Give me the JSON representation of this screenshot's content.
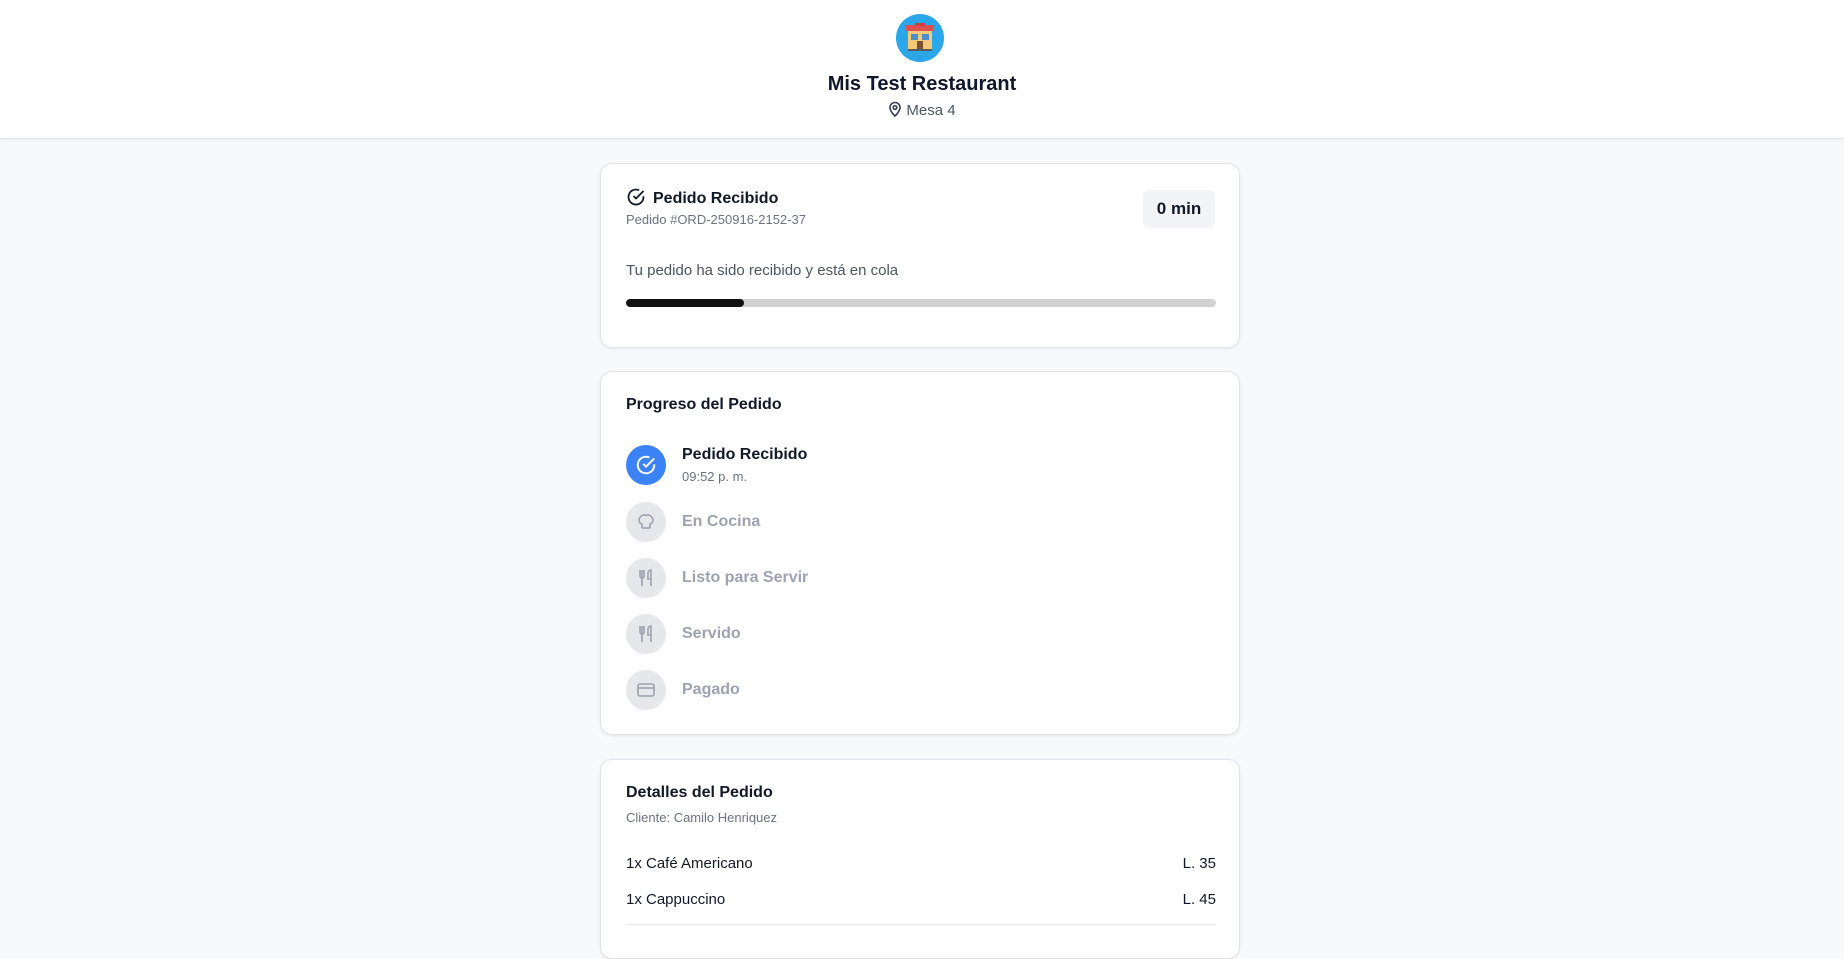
{
  "header": {
    "restaurant_name": "Mis Test Restaurant",
    "table_label": "Mesa 4",
    "logo_icon": "store-icon",
    "location_icon": "map-pin-icon"
  },
  "status_card": {
    "title": "Pedido Recibido",
    "order_number": "Pedido #ORD-250916-2152-37",
    "elapsed": "0 min",
    "description": "Tu pedido ha sido recibido y está en cola",
    "progress_fraction": 0.2
  },
  "progress_card": {
    "heading": "Progreso del Pedido",
    "steps": [
      {
        "label": "Pedido Recibido",
        "time": "09:52 p. m.",
        "icon": "check-circle-icon",
        "active": true
      },
      {
        "label": "En Cocina",
        "icon": "chef-hat-icon",
        "active": false
      },
      {
        "label": "Listo para Servir",
        "icon": "utensils-icon",
        "active": false
      },
      {
        "label": "Servido",
        "icon": "utensils-icon",
        "active": false
      },
      {
        "label": "Pagado",
        "icon": "credit-card-icon",
        "active": false
      }
    ]
  },
  "details_card": {
    "heading": "Detalles del Pedido",
    "customer": "Cliente: Camilo Henriquez",
    "items": [
      {
        "name": "1x Café Americano",
        "price": "L. 35"
      },
      {
        "name": "1x Cappuccino",
        "price": "L. 45"
      }
    ]
  },
  "colors": {
    "accent": "#3b82f6",
    "logo_bg": "#2ba6e8",
    "progress_fill": "#111111",
    "inactive": "#9ca3af"
  }
}
